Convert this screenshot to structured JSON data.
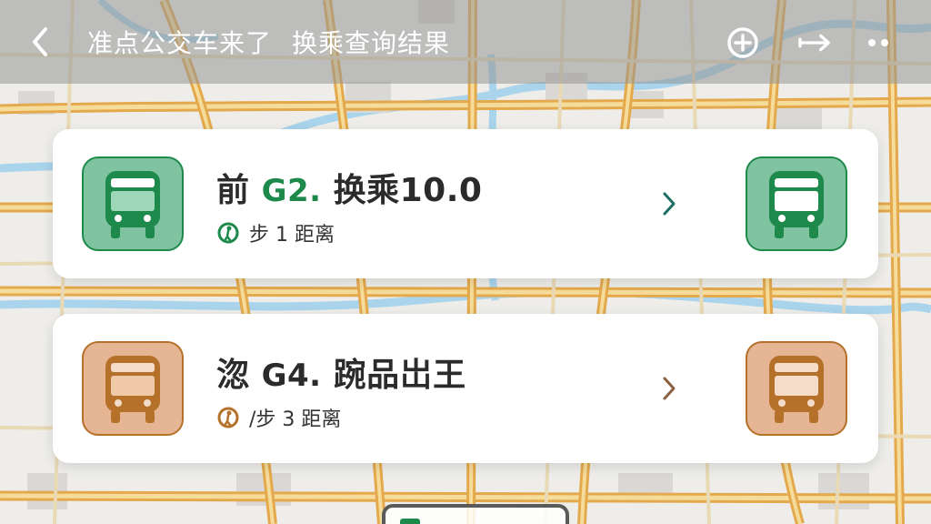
{
  "header": {
    "title_app": "准点公交车来了",
    "title_page": "换乘查询结果",
    "back_icon": "chevron-left-icon",
    "add_icon": "add-circle-icon",
    "share_icon": "arrow-right-icon",
    "more_icon": "more-dots-icon",
    "bg_color": "#969696"
  },
  "routes": [
    {
      "prefix": "前",
      "route": "G2.",
      "name": "换乘10.0",
      "walk_text": "步 1 距离",
      "accent": "#1d8a4c",
      "tile_color": "#7fc3a0"
    },
    {
      "prefix": "淴",
      "route": "G4.",
      "name": "踠品岀王",
      "walk_text": "/步 3 距离",
      "accent": "#b5702a",
      "tile_color": "#e5b594"
    }
  ],
  "colors": {
    "map_bg": "#eeede9",
    "road": "#f0c978",
    "water": "#a9d4ec"
  }
}
